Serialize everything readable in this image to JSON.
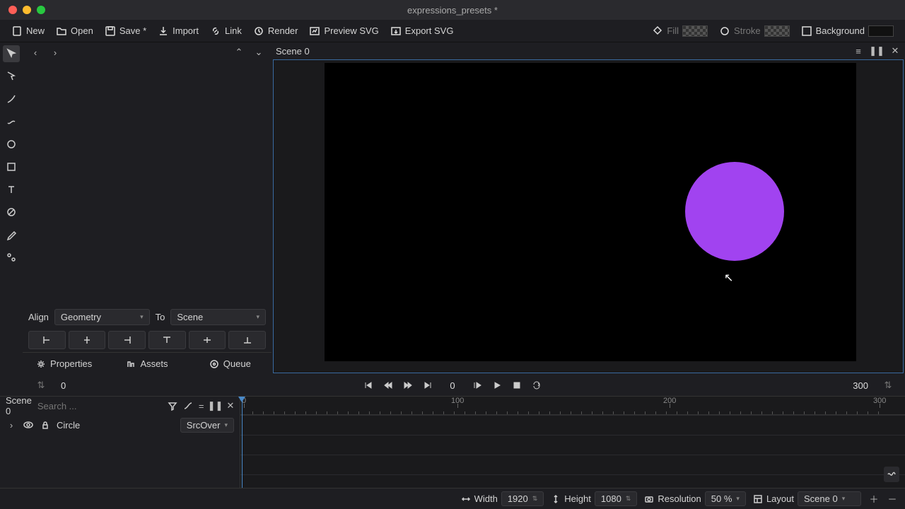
{
  "title": "expressions_presets *",
  "toolbar": {
    "new": "New",
    "open": "Open",
    "save": "Save *",
    "import": "Import",
    "link": "Link",
    "render": "Render",
    "preview": "Preview SVG",
    "export": "Export SVG",
    "fill": "Fill",
    "stroke": "Stroke",
    "background": "Background"
  },
  "scene_name": "Scene 0",
  "align": {
    "label": "Align",
    "mode": "Geometry",
    "to_label": "To",
    "to": "Scene"
  },
  "tabs": {
    "properties": "Properties",
    "assets": "Assets",
    "queue": "Queue"
  },
  "playback": {
    "frame_start": "0",
    "current": "0",
    "frame_end": "300"
  },
  "timeline": {
    "scene": "Scene 0",
    "search_placeholder": "Search ...",
    "layer": "Circle",
    "blend": "SrcOver",
    "ticks": [
      "0",
      "100",
      "200",
      "300"
    ]
  },
  "status": {
    "width_label": "Width",
    "width": "1920",
    "height_label": "Height",
    "height": "1080",
    "res_label": "Resolution",
    "res": "50 %",
    "layout_label": "Layout",
    "layout": "Scene 0"
  }
}
